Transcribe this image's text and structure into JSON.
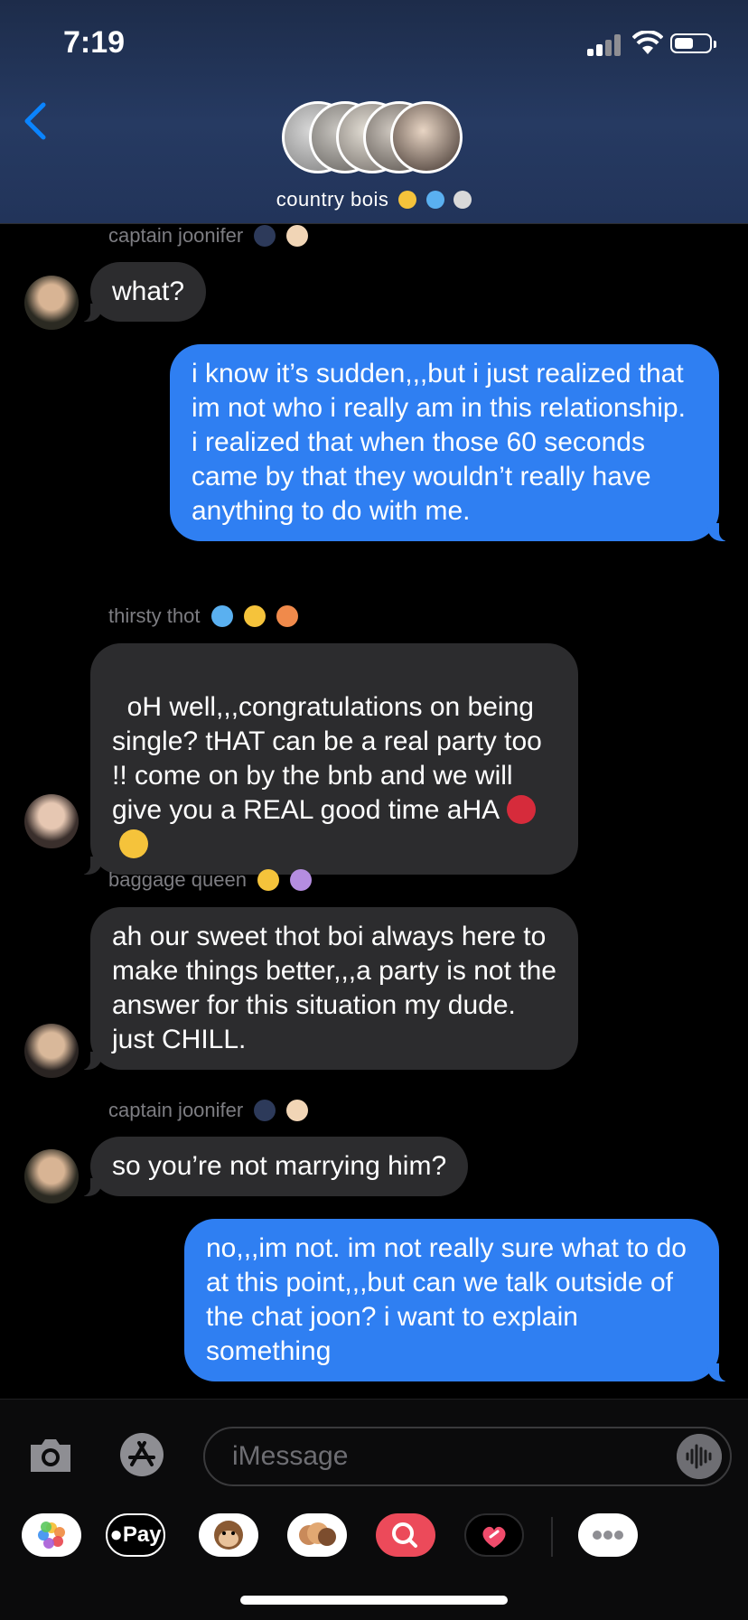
{
  "status_bar": {
    "time": "7:19"
  },
  "header": {
    "group_name": "country bois"
  },
  "messages": [
    {
      "sender": "captain joonifer",
      "text": "what?"
    },
    {
      "text": "i know it’s sudden,,,but i just realized that im not who i really am in this relationship. i realized that when those 60 seconds came by that they wouldn’t really have anything to do with me."
    },
    {
      "sender": "thirsty thot",
      "text": "oH well,,,congratulations on being single? tHAT can be a real party too !! come on by the bnb and we will give you a REAL good time aHA"
    },
    {
      "sender": "baggage queen",
      "text": "ah our sweet thot boi always here to make things better,,,a party is not the answer for this situation my dude. just CHILL."
    },
    {
      "sender": "captain joonifer",
      "text": "so you’re not marrying him?"
    },
    {
      "text": "no,,,im not. im not really sure what to do at this point,,,but can we talk outside of the chat joon? i want to explain something"
    }
  ],
  "input": {
    "placeholder": "iMessage"
  },
  "apps": {
    "apple_pay_label": "Pay"
  },
  "colors": {
    "outgoing_bubble": "#2f7ff2",
    "incoming_bubble": "#2c2c2e",
    "accent": "#0a84ff"
  }
}
